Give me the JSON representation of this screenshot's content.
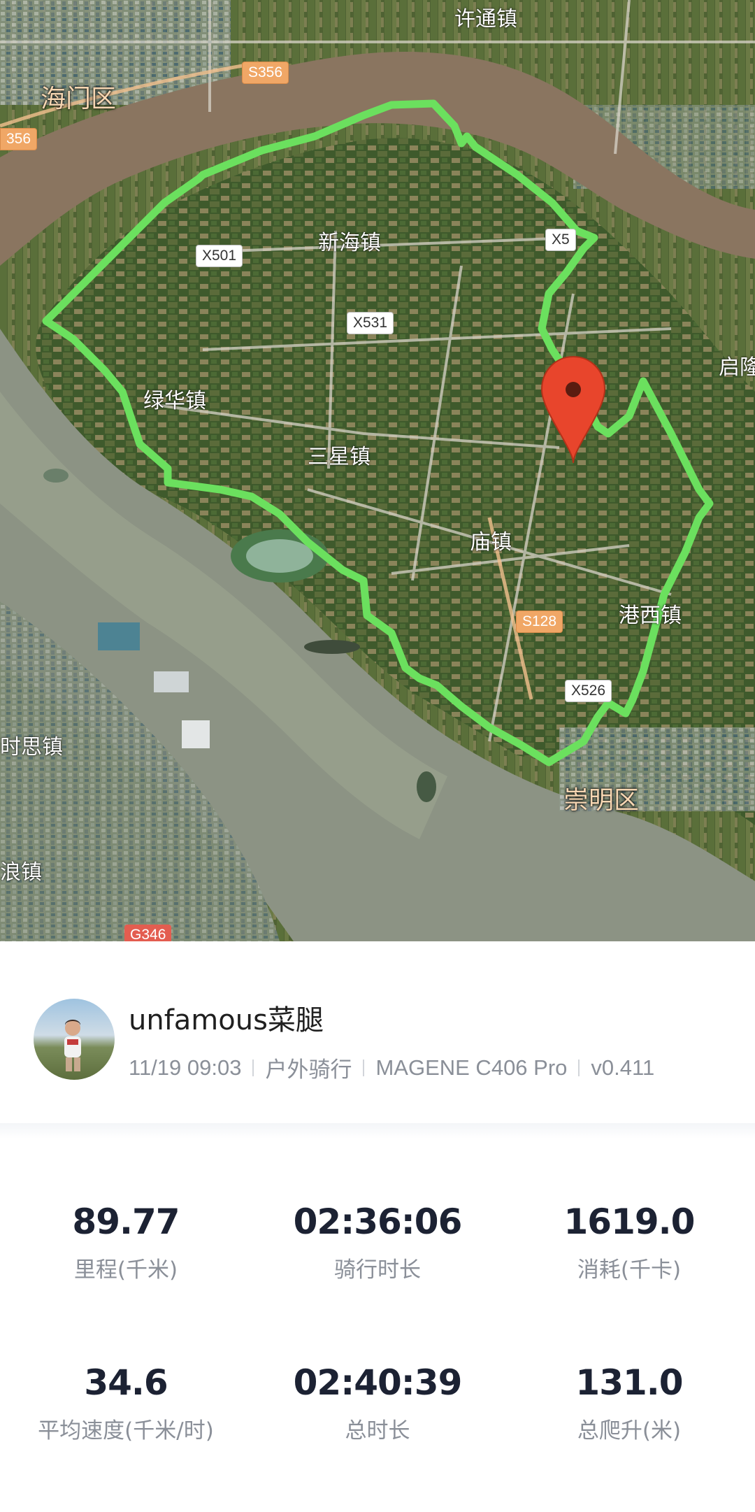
{
  "map": {
    "place_labels": {
      "haimen": "海门区",
      "xutong": "许通镇",
      "xinhai": "新海镇",
      "lvhua": "绿华镇",
      "sanxing": "三星镇",
      "miao": "庙镇",
      "gangxi": "港西镇",
      "chongming": "崇明区",
      "qilong": "启隆",
      "shisi": "时思镇",
      "langzhen": "浪镇"
    },
    "road_labels": {
      "s356_top": "S356",
      "s356_left": "356",
      "x501": "X501",
      "x531": "X531",
      "x5_partial": "X5",
      "s128": "S128",
      "x526": "X526",
      "g346": "G346"
    },
    "route_color": "#6be05e",
    "marker_color": "#e8452c"
  },
  "profile": {
    "username": "unfamous菜腿",
    "datetime": "11/19 09:03",
    "activity_type": "户外骑行",
    "device": "MAGENE C406 Pro",
    "version": "v0.411"
  },
  "stats": {
    "distance": {
      "value": "89.77",
      "label": "里程(千米)"
    },
    "ride_time": {
      "value": "02:36:06",
      "label": "骑行时长"
    },
    "calories": {
      "value": "1619.0",
      "label": "消耗(千卡)"
    },
    "avg_speed": {
      "value": "34.6",
      "label": "平均速度(千米/时)"
    },
    "total_time": {
      "value": "02:40:39",
      "label": "总时长"
    },
    "elevation": {
      "value": "131.0",
      "label": "总爬升(米)"
    }
  }
}
